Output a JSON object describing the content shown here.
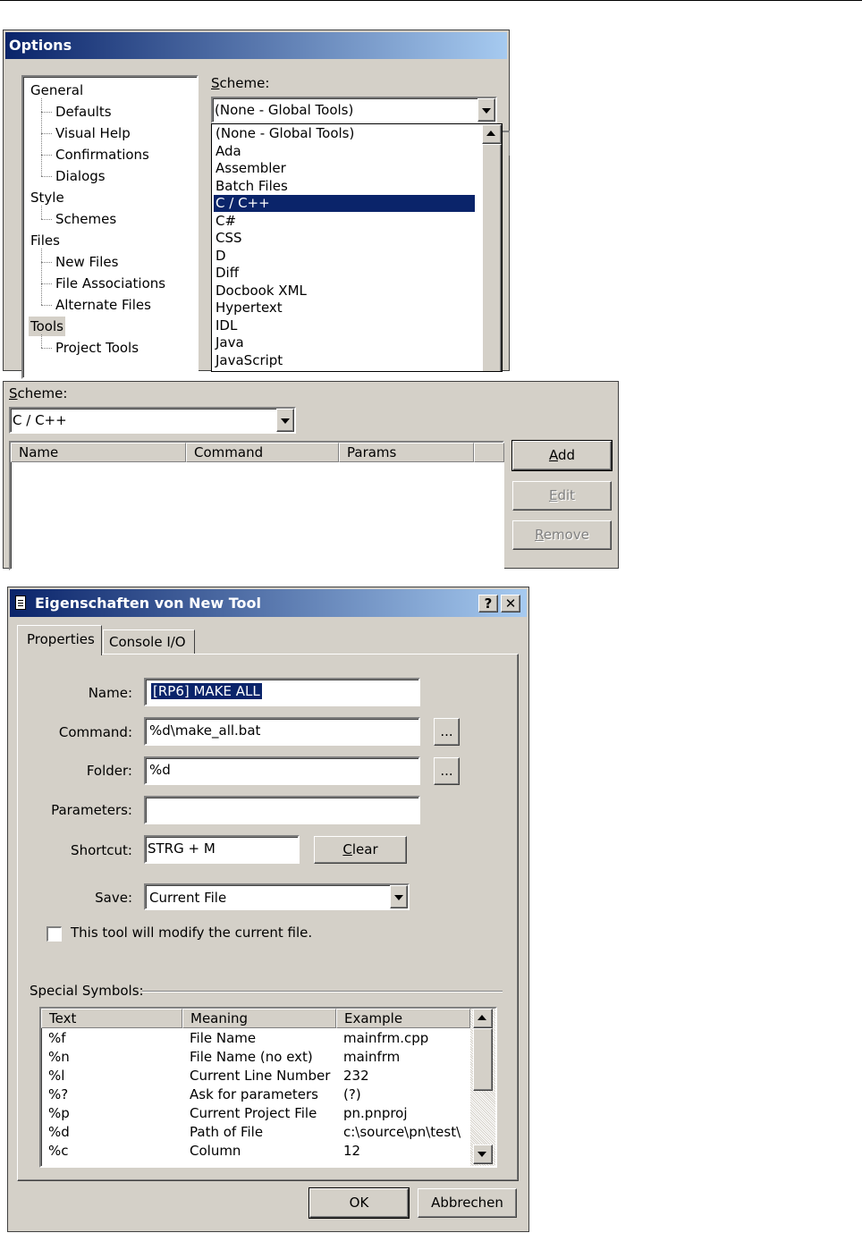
{
  "options_dialog": {
    "title": "Options",
    "tree": [
      {
        "label": "General",
        "level": 0
      },
      {
        "label": "Defaults",
        "level": 1
      },
      {
        "label": "Visual Help",
        "level": 1
      },
      {
        "label": "Confirmations",
        "level": 1
      },
      {
        "label": "Dialogs",
        "level": 1
      },
      {
        "label": "Style",
        "level": 0
      },
      {
        "label": "Schemes",
        "level": 1
      },
      {
        "label": "Files",
        "level": 0
      },
      {
        "label": "New Files",
        "level": 1
      },
      {
        "label": "File Associations",
        "level": 1
      },
      {
        "label": "Alternate Files",
        "level": 1
      },
      {
        "label": "Tools",
        "level": 0,
        "selected": true
      },
      {
        "label": "Project Tools",
        "level": 1
      }
    ],
    "scheme_label_underlined": "S",
    "scheme_label_rest": "cheme:",
    "scheme_value": "(None - Global Tools)",
    "scheme_options": [
      "(None - Global Tools)",
      "Ada",
      "Assembler",
      "Batch Files",
      "C / C++",
      "C#",
      "CSS",
      "D",
      "Diff",
      "Docbook XML",
      "Hypertext",
      "IDL",
      "Java",
      "JavaScript"
    ],
    "scheme_highlighted": "C / C++"
  },
  "tools_panel": {
    "scheme_label_underlined": "S",
    "scheme_label_rest": "cheme:",
    "scheme_value": "C / C++",
    "columns": [
      "Name",
      "Command",
      "Params"
    ],
    "add_underlined": "A",
    "add_rest": "dd",
    "edit_underlined": "E",
    "edit_rest": "dit",
    "remove_underlined": "R",
    "remove_rest": "emove"
  },
  "properties_dialog": {
    "title": "Eigenschaften von New Tool",
    "help_button": "?",
    "close_button": "✕",
    "tabs": [
      "Properties",
      "Console I/O"
    ],
    "name_label": "Name:",
    "name_value": "[RP6] MAKE ALL",
    "command_label": "Command:",
    "command_value": "%d\\make_all.bat",
    "folder_label": "Folder:",
    "folder_value": "%d",
    "browse_label": "...",
    "parameters_label": "Parameters:",
    "parameters_value": "",
    "shortcut_label": "Shortcut:",
    "shortcut_value": "STRG + M",
    "clear_underlined": "C",
    "clear_rest": "lear",
    "save_label": "Save:",
    "save_value": "Current File",
    "modify_checkbox_label": "This tool will modify the current file.",
    "modify_checked": false,
    "special_symbols_label": "Special Symbols:",
    "symbol_columns": [
      "Text",
      "Meaning",
      "Example"
    ],
    "symbols": [
      {
        "text": "%f",
        "meaning": "File Name",
        "example": "mainfrm.cpp"
      },
      {
        "text": "%n",
        "meaning": "File Name (no ext)",
        "example": "mainfrm"
      },
      {
        "text": "%l",
        "meaning": "Current Line Number",
        "example": "232"
      },
      {
        "text": "%?",
        "meaning": "Ask for parameters",
        "example": "(?)"
      },
      {
        "text": "%p",
        "meaning": "Current Project File",
        "example": "pn.pnproj"
      },
      {
        "text": "%d",
        "meaning": "Path of File",
        "example": "c:\\source\\pn\\test\\"
      },
      {
        "text": "%c",
        "meaning": "Column",
        "example": "12"
      }
    ],
    "ok_label": "OK",
    "cancel_label": "Abbrechen"
  },
  "colors": {
    "window_face": "#d4d0c8",
    "title_gradient_start": "#0a246a",
    "title_gradient_end": "#a6caf0",
    "selection": "#0a246a"
  }
}
